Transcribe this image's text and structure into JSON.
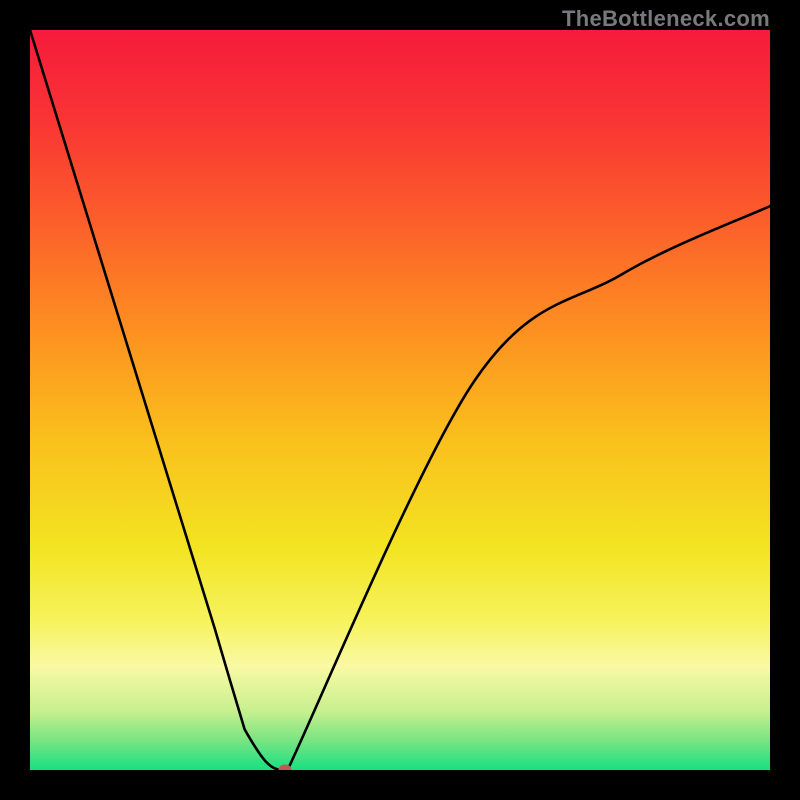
{
  "watermark": "TheBottleneck.com",
  "chart_data": {
    "type": "line",
    "title": "",
    "xlabel": "",
    "ylabel": "",
    "xlim": [
      0,
      1
    ],
    "ylim": [
      0,
      1
    ],
    "x": [
      0.0,
      0.05,
      0.1,
      0.15,
      0.2,
      0.25,
      0.27,
      0.29,
      0.31,
      0.33,
      0.6,
      0.8,
      1.0
    ],
    "values": [
      1.0,
      0.838,
      0.676,
      0.514,
      0.352,
      0.19,
      0.122,
      0.055,
      0.02,
      0.0,
      0.525,
      0.67,
      0.762
    ],
    "annotations": [
      {
        "name": "marker",
        "x": 0.345,
        "y": 0.0,
        "color": "#c05a54"
      }
    ],
    "background_gradient_stops": [
      {
        "pos": 0.0,
        "color": "#f61b3c"
      },
      {
        "pos": 0.12,
        "color": "#f93434"
      },
      {
        "pos": 0.25,
        "color": "#fc5c2b"
      },
      {
        "pos": 0.4,
        "color": "#fd8e21"
      },
      {
        "pos": 0.55,
        "color": "#fabf1c"
      },
      {
        "pos": 0.7,
        "color": "#f3e422"
      },
      {
        "pos": 0.8,
        "color": "#f6f35e"
      },
      {
        "pos": 0.86,
        "color": "#faf9a4"
      },
      {
        "pos": 0.92,
        "color": "#c7f08f"
      },
      {
        "pos": 0.96,
        "color": "#7ae482"
      },
      {
        "pos": 1.0,
        "color": "#17e081"
      }
    ]
  }
}
